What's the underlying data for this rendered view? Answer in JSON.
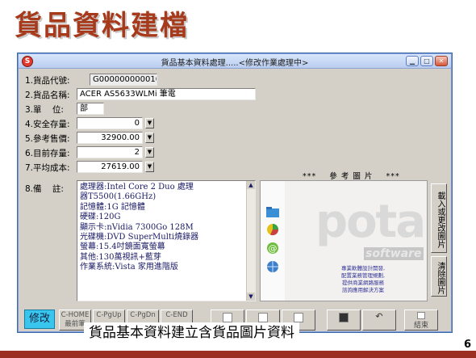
{
  "slide": {
    "title": "貨品資料建檔",
    "caption": "貨品基本資料建立含貨品圖片資料",
    "page_number": "6"
  },
  "window": {
    "title": "貨品基本資料處理.....<修改作業處理中>",
    "controls": [
      "minimize",
      "maximize",
      "close"
    ]
  },
  "fields": [
    {
      "label": "1.貨品代號:",
      "value": "G000000000010"
    },
    {
      "label": "2.貨品名稱:",
      "value": "ACER AS5633WLMi 筆電"
    },
    {
      "label": "3.單    位:",
      "value": "部"
    },
    {
      "label": "4.安全存量:",
      "value": "0"
    },
    {
      "label": "5.參考售價:",
      "value": "32900.00"
    },
    {
      "label": "6.目前存量:",
      "value": "2"
    },
    {
      "label": "7.平均成本:",
      "value": "27619.00"
    }
  ],
  "notes": {
    "label": "8.備    註:",
    "lines": [
      "處理器:Intel Core 2 Duo 處理",
      "器T5500(1.66GHz)",
      "記憶體:1G 記憶體",
      "硬碟:120G",
      "顯示卡:nVidia 7300Go 128M",
      "光碟機:DVD SuperMulti燒錄器",
      "螢幕:15.4吋鏡面寬螢幕",
      "其他:130萬視訊+藍芽",
      "作業系統:Vista 家用進階版"
    ]
  },
  "photo": {
    "caption": "***    參 考 圖 片    ***",
    "logo_text": "pota",
    "logo_sub": "software",
    "promo_lines": [
      "專業軟體設計開發,",
      "配置業務管理規劃,",
      "提供商業網路服務",
      "諮詢應用解決方案"
    ],
    "side_buttons": [
      "載入或更改圖片",
      "清除圖片"
    ]
  },
  "toolbar": {
    "mode": "修改",
    "keys": [
      {
        "top": "C-HOME",
        "bottom": "最前筆"
      },
      {
        "top": "C-PgUp",
        "bottom": ""
      },
      {
        "top": "C-PgDn",
        "bottom": ""
      },
      {
        "top": "C-END",
        "bottom": ""
      }
    ],
    "exit_label": "結束"
  }
}
